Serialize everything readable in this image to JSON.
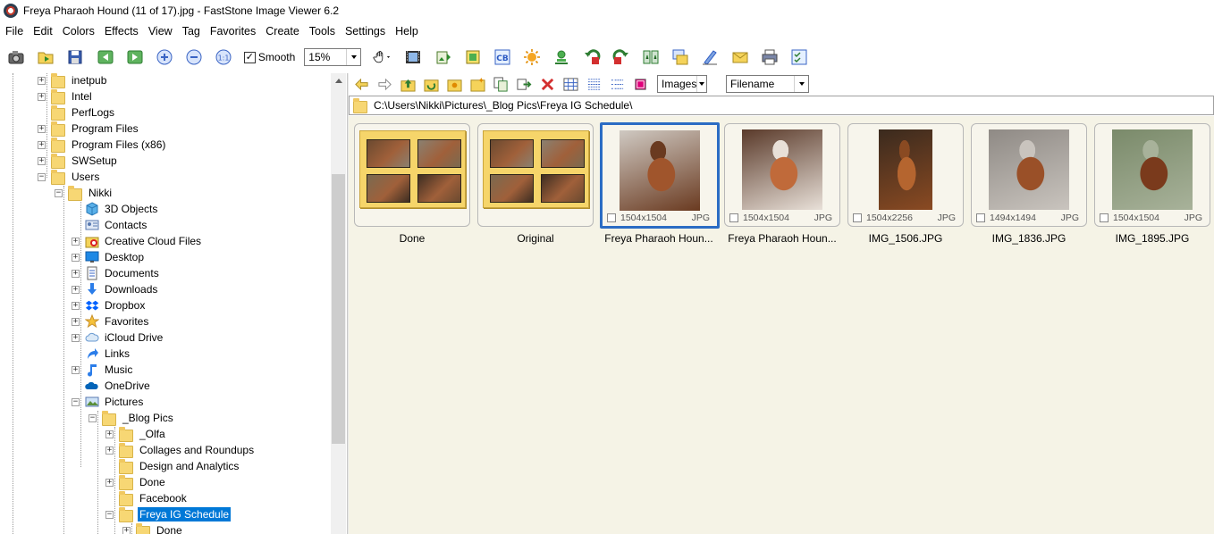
{
  "window": {
    "title": "Freya Pharaoh Hound (11 of 17).jpg  -  FastStone Image Viewer 6.2"
  },
  "menu": [
    "File",
    "Edit",
    "Colors",
    "Effects",
    "View",
    "Tag",
    "Favorites",
    "Create",
    "Tools",
    "Settings",
    "Help"
  ],
  "toolbar": {
    "smooth_label": "Smooth",
    "smooth_checked": true,
    "smooth_mark": "✓",
    "zoom_value": "15%"
  },
  "browser_toolbar": {
    "filter_value": "Images",
    "sort_value": "Filename"
  },
  "path": "C:\\Users\\Nikki\\Pictures\\_Blog Pics\\Freya IG Schedule\\",
  "tree": [
    {
      "label": "inetpub",
      "icon": "folder-icon",
      "expander": "+"
    },
    {
      "label": "Intel",
      "icon": "folder-icon",
      "expander": "+"
    },
    {
      "label": "PerfLogs",
      "icon": "folder-icon",
      "expander": ""
    },
    {
      "label": "Program Files",
      "icon": "folder-icon",
      "expander": "+"
    },
    {
      "label": "Program Files (x86)",
      "icon": "folder-icon",
      "expander": "+"
    },
    {
      "label": "SWSetup",
      "icon": "folder-icon",
      "expander": "+"
    },
    {
      "label": "Users",
      "icon": "folder-icon",
      "expander": "−"
    },
    {
      "label": "Nikki",
      "icon": "folder-icon",
      "expander": "−"
    },
    {
      "label": "3D Objects",
      "icon": "cube-icon",
      "expander": ""
    },
    {
      "label": "Contacts",
      "icon": "contacts-icon",
      "expander": ""
    },
    {
      "label": "Creative Cloud Files",
      "icon": "creative-cloud-icon",
      "expander": "+"
    },
    {
      "label": "Desktop",
      "icon": "desktop-icon",
      "expander": "+"
    },
    {
      "label": "Documents",
      "icon": "documents-icon",
      "expander": "+"
    },
    {
      "label": "Downloads",
      "icon": "download-arrow-icon",
      "expander": "+"
    },
    {
      "label": "Dropbox",
      "icon": "dropbox-icon",
      "expander": "+"
    },
    {
      "label": "Favorites",
      "icon": "star-icon",
      "expander": "+"
    },
    {
      "label": "iCloud Drive",
      "icon": "icloud-icon",
      "expander": "+"
    },
    {
      "label": "Links",
      "icon": "link-arrow-icon",
      "expander": ""
    },
    {
      "label": "Music",
      "icon": "music-note-icon",
      "expander": "+"
    },
    {
      "label": "OneDrive",
      "icon": "onedrive-cloud-icon",
      "expander": ""
    },
    {
      "label": "Pictures",
      "icon": "pictures-icon",
      "expander": "−"
    },
    {
      "label": "_Blog Pics",
      "icon": "folder-icon",
      "expander": "−"
    },
    {
      "label": "_Olfa",
      "icon": "folder-icon",
      "expander": "+"
    },
    {
      "label": "Collages and Roundups",
      "icon": "folder-icon",
      "expander": "+"
    },
    {
      "label": "Design and Analytics",
      "icon": "folder-icon",
      "expander": ""
    },
    {
      "label": "Done",
      "icon": "folder-icon",
      "expander": "+"
    },
    {
      "label": "Facebook",
      "icon": "folder-icon",
      "expander": ""
    },
    {
      "label": "Freya IG Schedule",
      "icon": "folder-icon",
      "expander": "−",
      "selected": true
    },
    {
      "label": "Done",
      "icon": "folder-icon",
      "expander": "+"
    }
  ],
  "thumbnails": [
    {
      "name": "Done",
      "type": "folder"
    },
    {
      "name": "Original",
      "type": "folder"
    },
    {
      "name": "Freya Pharaoh Houn...",
      "type": "image",
      "dims": "1504x1504",
      "ext": "JPG",
      "selected": true
    },
    {
      "name": "Freya Pharaoh Houn...",
      "type": "image",
      "dims": "1504x1504",
      "ext": "JPG"
    },
    {
      "name": "IMG_1506.JPG",
      "type": "image",
      "dims": "1504x2256",
      "ext": "JPG"
    },
    {
      "name": "IMG_1836.JPG",
      "type": "image",
      "dims": "1494x1494",
      "ext": "JPG"
    },
    {
      "name": "IMG_1895.JPG",
      "type": "image",
      "dims": "1504x1504",
      "ext": "JPG"
    }
  ]
}
